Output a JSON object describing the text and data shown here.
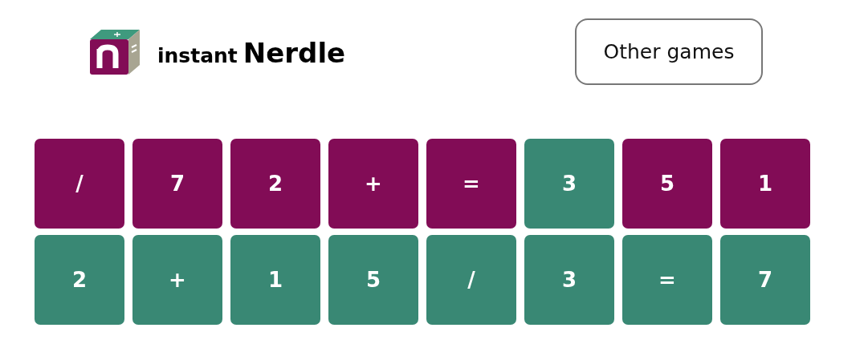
{
  "header": {
    "brand_prefix": "instant",
    "brand_name": "Nerdle",
    "button": "Other games"
  },
  "board": [
    [
      {
        "char": "/",
        "correct": false
      },
      {
        "char": "7",
        "correct": false
      },
      {
        "char": "2",
        "correct": false
      },
      {
        "char": "+",
        "correct": false
      },
      {
        "char": "=",
        "correct": false
      },
      {
        "char": "3",
        "correct": true
      },
      {
        "char": "5",
        "correct": false
      },
      {
        "char": "1",
        "correct": false
      }
    ],
    [
      {
        "char": "2",
        "correct": true
      },
      {
        "char": "+",
        "correct": true
      },
      {
        "char": "1",
        "correct": true
      },
      {
        "char": "5",
        "correct": true
      },
      {
        "char": "/",
        "correct": true
      },
      {
        "char": "3",
        "correct": true
      },
      {
        "char": "=",
        "correct": true
      },
      {
        "char": "7",
        "correct": true
      }
    ]
  ]
}
